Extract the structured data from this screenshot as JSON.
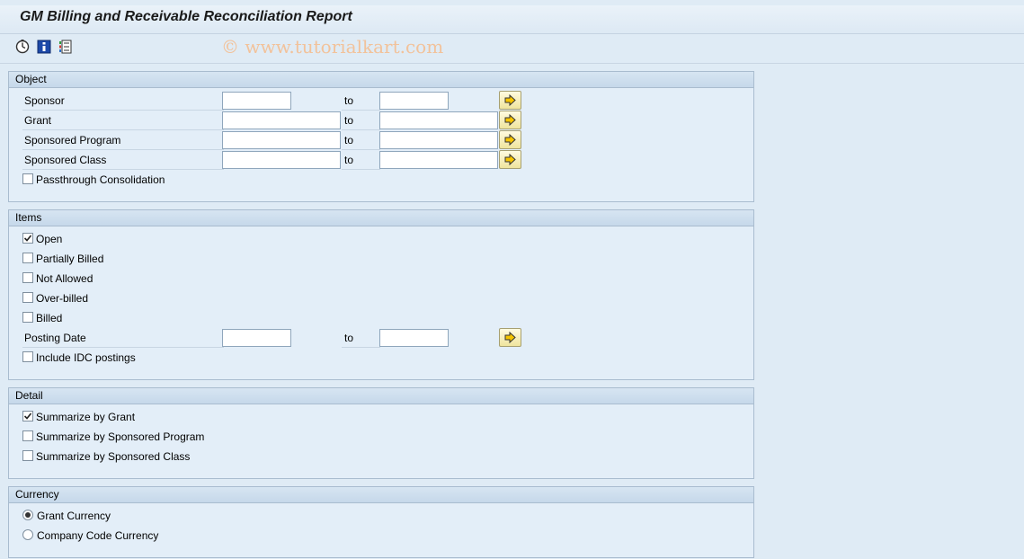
{
  "title": "GM Billing and Receivable Reconciliation Report",
  "watermark": "© www.tutorialkart.com",
  "toolbar": {
    "icons": [
      "execute-icon",
      "info-icon",
      "selection-screen-icon"
    ]
  },
  "range_to_label": "to",
  "object": {
    "header": "Object",
    "sponsor": {
      "label": "Sponsor",
      "from": "",
      "to": ""
    },
    "grant": {
      "label": "Grant",
      "from": "",
      "to": ""
    },
    "sponsored_program": {
      "label": "Sponsored Program",
      "from": "",
      "to": ""
    },
    "sponsored_class": {
      "label": "Sponsored Class",
      "from": "",
      "to": ""
    },
    "passthrough": {
      "label": "Passthrough Consolidation",
      "checked": false
    }
  },
  "items": {
    "header": "Items",
    "open": {
      "label": "Open",
      "checked": true
    },
    "partially_billed": {
      "label": "Partially Billed",
      "checked": false
    },
    "not_allowed": {
      "label": "Not Allowed",
      "checked": false
    },
    "over_billed": {
      "label": "Over-billed",
      "checked": false
    },
    "billed": {
      "label": "Billed",
      "checked": false
    },
    "posting_date": {
      "label": "Posting Date",
      "from": "",
      "to": ""
    },
    "include_idc": {
      "label": "Include IDC postings",
      "checked": false
    }
  },
  "detail": {
    "header": "Detail",
    "by_grant": {
      "label": "Summarize by Grant",
      "checked": true
    },
    "by_program": {
      "label": "Summarize by Sponsored Program",
      "checked": false
    },
    "by_class": {
      "label": "Summarize by Sponsored Class",
      "checked": false
    }
  },
  "currency": {
    "header": "Currency",
    "grant_currency": {
      "label": "Grant Currency",
      "selected": true
    },
    "company_code_currency": {
      "label": "Company Code Currency",
      "selected": false
    }
  },
  "colors": {
    "background": "#dfebf5",
    "group_header": "#c6d8ea",
    "arrow_button": "#efe49d"
  }
}
